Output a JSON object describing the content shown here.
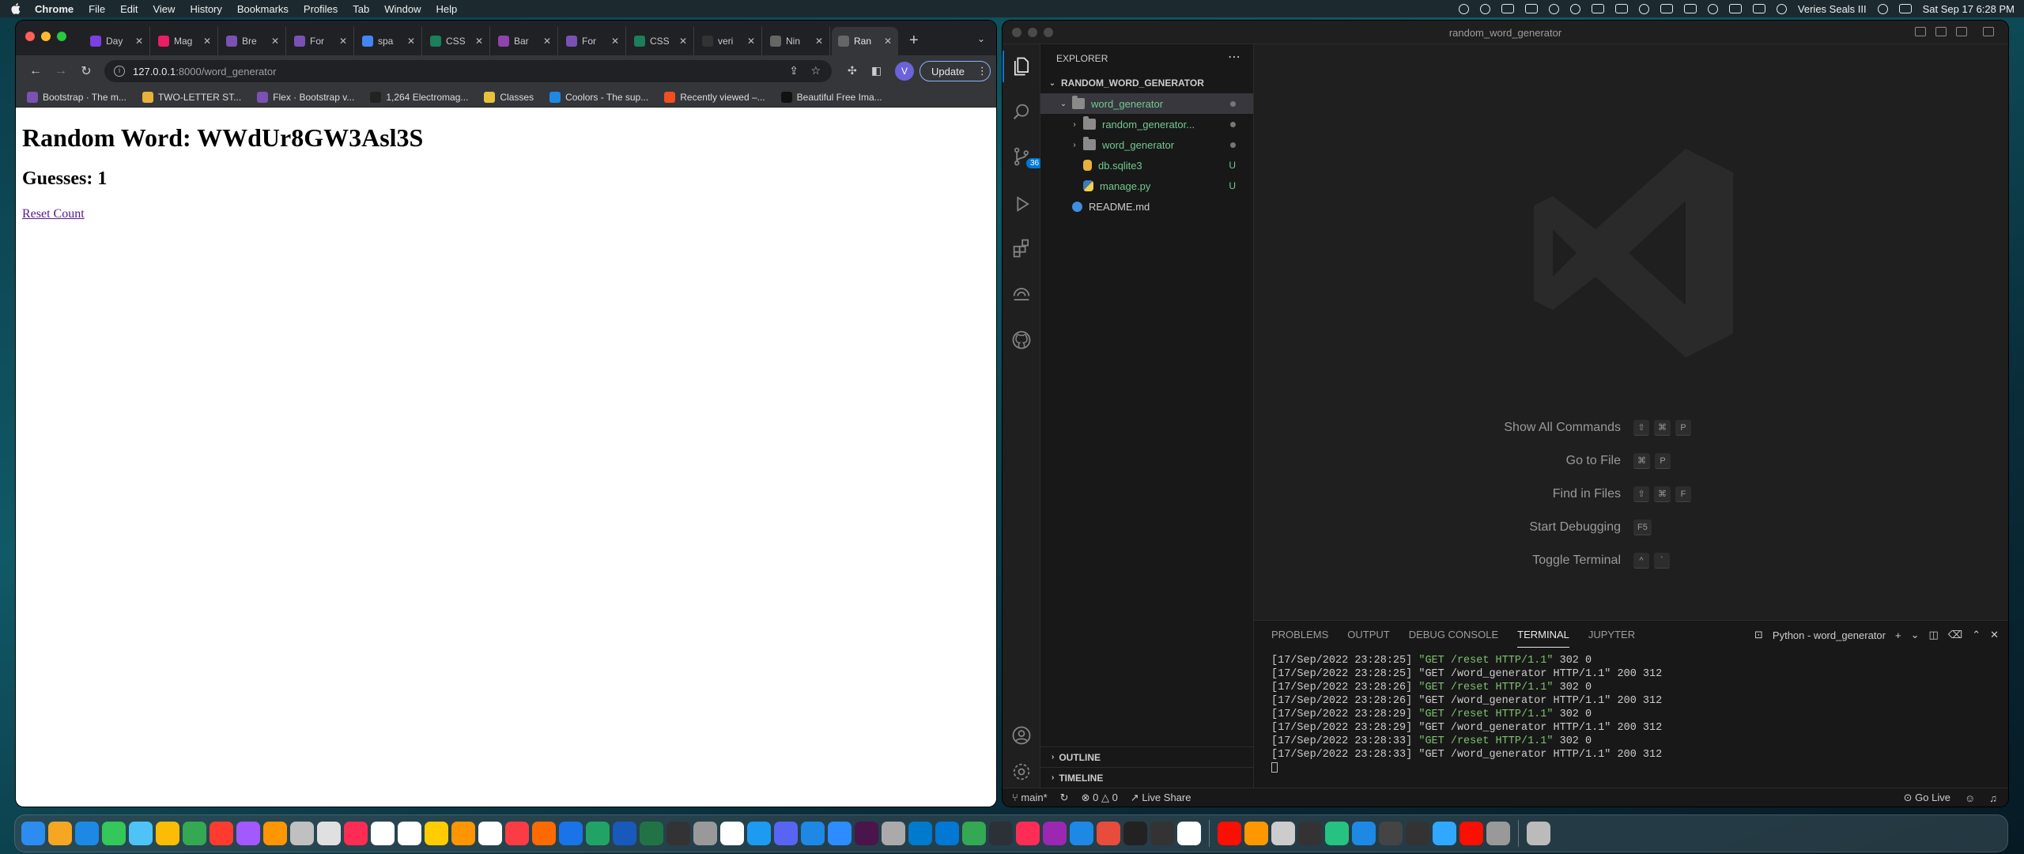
{
  "menubar": {
    "app_name": "Chrome",
    "items": [
      "File",
      "Edit",
      "View",
      "History",
      "Bookmarks",
      "Profiles",
      "Tab",
      "Window",
      "Help"
    ],
    "user": "Veries Seals III",
    "datetime": "Sat Sep 17  6:28 PM"
  },
  "chrome": {
    "tabs": [
      {
        "label": "Day",
        "favicon_color": "#7b3fe4"
      },
      {
        "label": "Mag",
        "favicon_color": "#e91e63"
      },
      {
        "label": "Bre",
        "favicon_color": "#7952b3"
      },
      {
        "label": "For",
        "favicon_color": "#7952b3"
      },
      {
        "label": "spa",
        "favicon_color": "#4285f4"
      },
      {
        "label": "CSS",
        "favicon_color": "#1a7f5a"
      },
      {
        "label": "Bar",
        "favicon_color": "#8e44ad"
      },
      {
        "label": "For",
        "favicon_color": "#7952b3"
      },
      {
        "label": "CSS",
        "favicon_color": "#1a7f5a"
      },
      {
        "label": "veri",
        "favicon_color": "#333333"
      },
      {
        "label": "Nin",
        "favicon_color": "#666666"
      },
      {
        "label": "Ran",
        "favicon_color": "#666666",
        "active": true
      }
    ],
    "url_host": "127.0.0.1",
    "url_path": ":8000/word_generator",
    "profile_initial": "V",
    "update_label": "Update",
    "bookmarks": [
      {
        "label": "Bootstrap · The m...",
        "color": "#7952b3"
      },
      {
        "label": "TWO-LETTER ST...",
        "color": "#e8b13a"
      },
      {
        "label": "Flex · Bootstrap v...",
        "color": "#7952b3"
      },
      {
        "label": "1,264 Electromag...",
        "color": "#222222"
      },
      {
        "label": "Classes",
        "color": "#e8c13a"
      },
      {
        "label": "Coolors - The sup...",
        "color": "#1e88e5"
      },
      {
        "label": "Recently viewed –...",
        "color": "#f24e1e"
      },
      {
        "label": "Beautiful Free Ima...",
        "color": "#111111"
      }
    ],
    "page": {
      "heading": "Random Word: WWdUr8GW3Asl3S",
      "guesses": "Guesses: 1",
      "reset_link": "Reset Count"
    }
  },
  "vscode": {
    "window_title": "random_word_generator",
    "scm_badge": "36",
    "explorer_title": "EXPLORER",
    "root_folder": "RANDOM_WORD_GENERATOR",
    "tree": [
      {
        "name": "word_generator",
        "type": "folder-open",
        "indent": 1,
        "status": "dot",
        "selected": true
      },
      {
        "name": "random_generator...",
        "type": "folder",
        "indent": 2,
        "status": "dot"
      },
      {
        "name": "word_generator",
        "type": "folder",
        "indent": 2,
        "status": "dot"
      },
      {
        "name": "db.sqlite3",
        "type": "db",
        "indent": 2,
        "status": "U"
      },
      {
        "name": "manage.py",
        "type": "python",
        "indent": 2,
        "status": "U"
      },
      {
        "name": "README.md",
        "type": "info",
        "indent": 1,
        "status": ""
      }
    ],
    "outline": "OUTLINE",
    "timeline": "TIMELINE",
    "shortcuts": [
      {
        "label": "Show All Commands",
        "keys": [
          "⇧",
          "⌘",
          "P"
        ]
      },
      {
        "label": "Go to File",
        "keys": [
          "⌘",
          "P"
        ]
      },
      {
        "label": "Find in Files",
        "keys": [
          "⇧",
          "⌘",
          "F"
        ]
      },
      {
        "label": "Start Debugging",
        "keys": [
          "F5"
        ]
      },
      {
        "label": "Toggle Terminal",
        "keys": [
          "^",
          "`"
        ]
      }
    ],
    "panel_tabs": [
      "PROBLEMS",
      "OUTPUT",
      "DEBUG CONSOLE",
      "TERMINAL",
      "JUPYTER"
    ],
    "active_panel_tab": "TERMINAL",
    "terminal_name": "Python - word_generator",
    "terminal_lines": [
      {
        "stamp": "[17/Sep/2022 23:28:25]",
        "req": "\"GET /reset HTTP/1.1\"",
        "tail": "302 0",
        "green": true
      },
      {
        "stamp": "[17/Sep/2022 23:28:25]",
        "req": "\"GET /word_generator HTTP/1.1\"",
        "tail": "200 312",
        "green": false
      },
      {
        "stamp": "[17/Sep/2022 23:28:26]",
        "req": "\"GET /reset HTTP/1.1\"",
        "tail": "302 0",
        "green": true
      },
      {
        "stamp": "[17/Sep/2022 23:28:26]",
        "req": "\"GET /word_generator HTTP/1.1\"",
        "tail": "200 312",
        "green": false
      },
      {
        "stamp": "[17/Sep/2022 23:28:29]",
        "req": "\"GET /reset HTTP/1.1\"",
        "tail": "302 0",
        "green": true
      },
      {
        "stamp": "[17/Sep/2022 23:28:29]",
        "req": "\"GET /word_generator HTTP/1.1\"",
        "tail": "200 312",
        "green": false
      },
      {
        "stamp": "[17/Sep/2022 23:28:33]",
        "req": "\"GET /reset HTTP/1.1\"",
        "tail": "302 0",
        "green": true
      },
      {
        "stamp": "[17/Sep/2022 23:28:33]",
        "req": "\"GET /word_generator HTTP/1.1\"",
        "tail": "200 312",
        "green": false
      }
    ],
    "status": {
      "branch": "main*",
      "errors": "0",
      "warnings": "0",
      "live_share": "Live Share",
      "go_live": "Go Live"
    }
  },
  "dock_colors": [
    "#2d8cf0",
    "#f5a623",
    "#1e88e5",
    "#34c759",
    "#4fc3f7",
    "#fbbc05",
    "#34a853",
    "#ff3b30",
    "#a259ff",
    "#ff9500",
    "#c0c0c0",
    "#e0e0e0",
    "#fe2c55",
    "#ffffff",
    "#ffffff",
    "#ffcc00",
    "#ff9500",
    "#ffffff",
    "#fc3c44",
    "#ff6a00",
    "#1a73e8",
    "#21a366",
    "#185abc",
    "#217346",
    "#333333",
    "#999999",
    "#ffffff",
    "#1d9bf0",
    "#5865f2",
    "#1e88e5",
    "#2d8cff",
    "#4a154b",
    "#aaaaaa",
    "#007acc",
    "#0078d4",
    "#34a853",
    "#2b3137",
    "#ff2d55",
    "#9c27b0",
    "#1e88e5",
    "#e74c3c",
    "#222222",
    "#333333",
    "#ffffff",
    "#fa0f00",
    "#ff9800",
    "#cccccc",
    "#333333",
    "#26c281",
    "#1e88e5",
    "#444444",
    "#333333",
    "#31a8ff",
    "#fa0f00",
    "#999999"
  ]
}
